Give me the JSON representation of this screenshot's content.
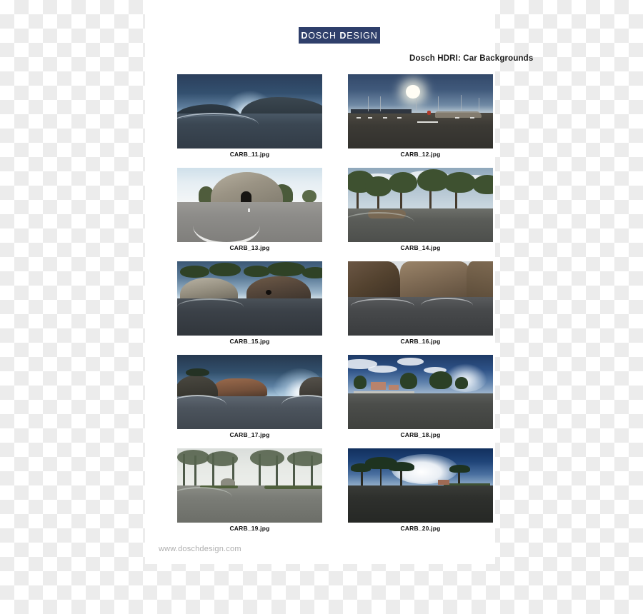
{
  "page": {
    "background_style": "transparent-checkerboard",
    "sheet_color": "#ffffff"
  },
  "logo": {
    "brand_first": "D",
    "brand_first_rest": "OSCH ",
    "brand_second": "D",
    "brand_second_rest": "ESIGN",
    "full_text": "DOSCH DESIGN",
    "background_color": "#2f3f6b",
    "text_color": "#ffffff"
  },
  "header": {
    "product_title": "Dosch HDRI: Car Backgrounds"
  },
  "gallery": {
    "rows": [
      [
        {
          "caption": "CARB_11.jpg",
          "scene": "dusk mountain road with sun glow on horizon",
          "art_class": "p11"
        },
        {
          "caption": "CARB_12.jpg",
          "scene": "sunny parking lot with bright sun and light poles",
          "art_class": "p12"
        }
      ],
      [
        {
          "caption": "CARB_13.jpg",
          "scene": "rock tunnel entrance on bright gray road",
          "art_class": "p13"
        },
        {
          "caption": "CARB_14.jpg",
          "scene": "forest road lined with tall trees",
          "art_class": "p14"
        }
      ],
      [
        {
          "caption": "CARB_15.jpg",
          "scene": "rocky cliffs topped with pine trees",
          "art_class": "p15"
        },
        {
          "caption": "CARB_16.jpg",
          "scene": "narrow canyon with brown rock walls",
          "art_class": "p16"
        }
      ],
      [
        {
          "caption": "CARB_17.jpg",
          "scene": "sunset mountain road with warm lit cliffs",
          "art_class": "p17"
        },
        {
          "caption": "CARB_18.jpg",
          "scene": "open lot with clouds, trees and buildings",
          "art_class": "p18"
        }
      ],
      [
        {
          "caption": "CARB_19.jpg",
          "scene": "foggy forest road under overcast sky",
          "art_class": "p19"
        },
        {
          "caption": "CARB_20.jpg",
          "scene": "umbrella pines under dramatic cloud bank",
          "art_class": "p20"
        }
      ]
    ]
  },
  "footer": {
    "website": "www.doschdesign.com",
    "text_color": "#aeaeae"
  }
}
